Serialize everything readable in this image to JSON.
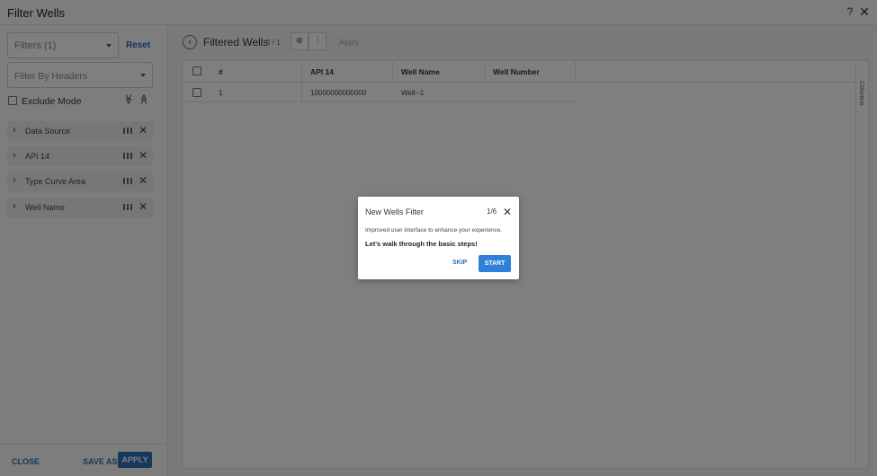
{
  "window": {
    "title": "Filter Wells"
  },
  "sidebar": {
    "filters_select_label": "Filters (1)",
    "reset_label": "Reset",
    "headers_select_placeholder": "Filter By Headers",
    "exclude_mode_label": "Exclude Mode",
    "expand_all_glyph": "≫",
    "collapse_all_glyph": "≪",
    "filter_items": [
      {
        "label": "Data Source"
      },
      {
        "label": "API 14"
      },
      {
        "label": "Type Curve Area"
      },
      {
        "label": "Well Name"
      }
    ],
    "close_label": "CLOSE",
    "save_as_label": "SAVE AS",
    "apply_label": "APPLY"
  },
  "main": {
    "title": "Filtered Wells",
    "count": "0 / 1",
    "apply_label": "Apply",
    "columns_rail_label": "Columns",
    "table": {
      "headers": [
        "#",
        "API 14",
        "Well Name",
        "Well Number"
      ],
      "rows": [
        {
          "num": "1",
          "api14": "10000000000000",
          "well_name": "Well--1",
          "well_number": ""
        }
      ]
    }
  },
  "modal": {
    "title": "New Wells Filter",
    "step": "1/6",
    "description": "Improved user interface to enhance your experience.",
    "bold_text": "Let's walk through the basic steps!",
    "skip_label": "SKIP",
    "start_label": "START"
  },
  "colors": {
    "accent": "#2f6fb6",
    "start_button": "#2f80d8",
    "overlay": "rgba(0,0,0,0.5)"
  }
}
